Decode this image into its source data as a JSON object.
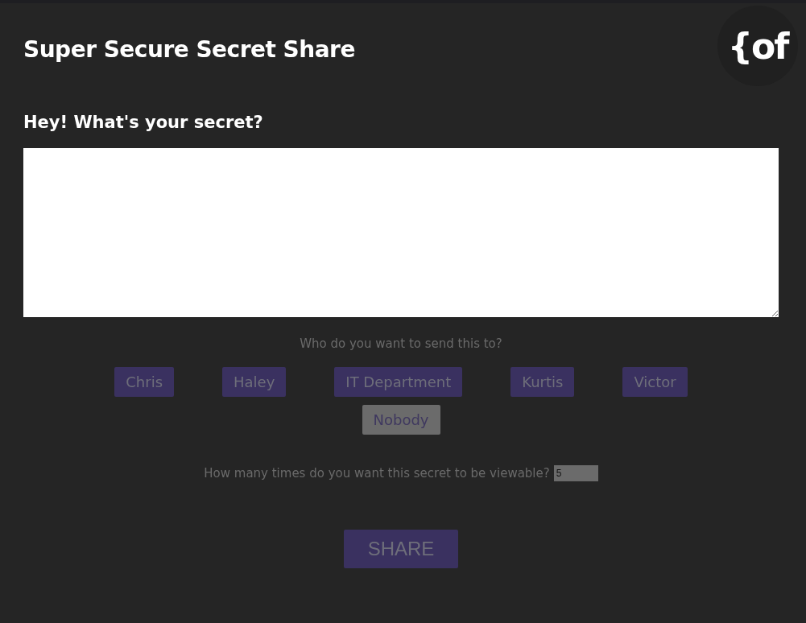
{
  "header": {
    "title": "Super Secure Secret Share",
    "logo": "{of"
  },
  "prompt": "Hey! What's your secret?",
  "recipients_label": "Who do you want to send this to?",
  "recipients": [
    {
      "label": "Chris",
      "selected": false
    },
    {
      "label": "Haley",
      "selected": false
    },
    {
      "label": "IT Department",
      "selected": false
    },
    {
      "label": "Kurtis",
      "selected": false
    },
    {
      "label": "Victor",
      "selected": false
    },
    {
      "label": "Nobody",
      "selected": true
    }
  ],
  "views": {
    "label": "How many times do you want this secret to be viewable?",
    "value": "5"
  },
  "submit": "SHARE"
}
